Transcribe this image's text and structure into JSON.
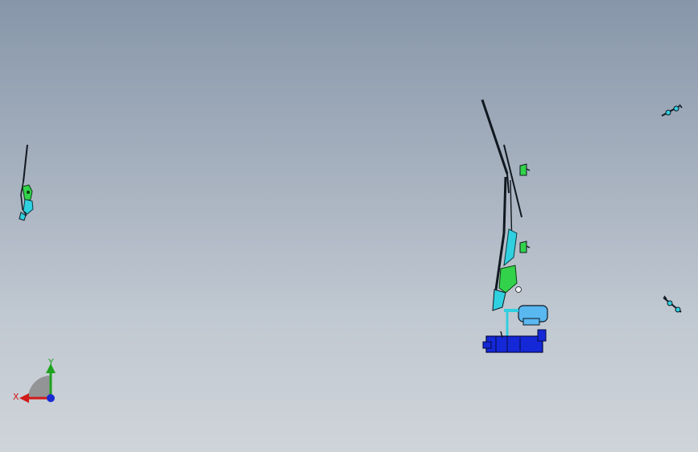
{
  "viewport": {
    "background_top": "#8796aa",
    "background_bottom": "#cfd4d9"
  },
  "model_colors": {
    "outline": "#101820",
    "cyan": "#2fd0e0",
    "green": "#32d24a",
    "blue": "#1428d8",
    "light_blue": "#59b8f0"
  },
  "triad": {
    "x_label": "X",
    "y_label": "Y",
    "x_color": "#d11a1a",
    "y_color": "#1fa31f",
    "z_color": "#1a2ad1",
    "sector_color": "#8a8a8a"
  },
  "icons": [
    "coordinate-triad-icon"
  ]
}
